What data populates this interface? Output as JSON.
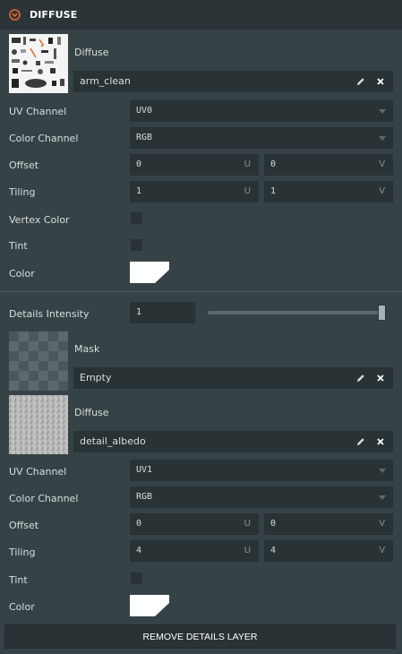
{
  "header": {
    "title": "DIFFUSE"
  },
  "diffuse": {
    "label": "Diffuse",
    "texture_name": "arm_clean",
    "uv_channel": {
      "label": "UV Channel",
      "value": "UV0"
    },
    "color_channel": {
      "label": "Color Channel",
      "value": "RGB"
    },
    "offset": {
      "label": "Offset",
      "u": "0",
      "v": "0",
      "u_axis": "U",
      "v_axis": "V"
    },
    "tiling": {
      "label": "Tiling",
      "u": "1",
      "v": "1",
      "u_axis": "U",
      "v_axis": "V"
    },
    "vertex_color": {
      "label": "Vertex Color"
    },
    "tint": {
      "label": "Tint"
    },
    "color": {
      "label": "Color",
      "value": "#ffffff"
    }
  },
  "details": {
    "intensity": {
      "label": "Details Intensity",
      "value": "1",
      "slider_level": 1.0
    },
    "mask": {
      "label": "Mask",
      "texture_name": "Empty"
    },
    "diffuse": {
      "label": "Diffuse",
      "texture_name": "detail_albedo"
    },
    "uv_channel": {
      "label": "UV Channel",
      "value": "UV1"
    },
    "color_channel": {
      "label": "Color Channel",
      "value": "RGB"
    },
    "offset": {
      "label": "Offset",
      "u": "0",
      "v": "0",
      "u_axis": "U",
      "v_axis": "V"
    },
    "tiling": {
      "label": "Tiling",
      "u": "4",
      "v": "4",
      "u_axis": "U",
      "v_axis": "V"
    },
    "tint": {
      "label": "Tint"
    },
    "color": {
      "label": "Color",
      "value": "#ffffff"
    },
    "remove_button": "REMOVE DETAILS LAYER"
  },
  "colors": {
    "accent": "#e8652b",
    "panel": "#364346",
    "field": "#293235",
    "header": "#2b3538"
  }
}
